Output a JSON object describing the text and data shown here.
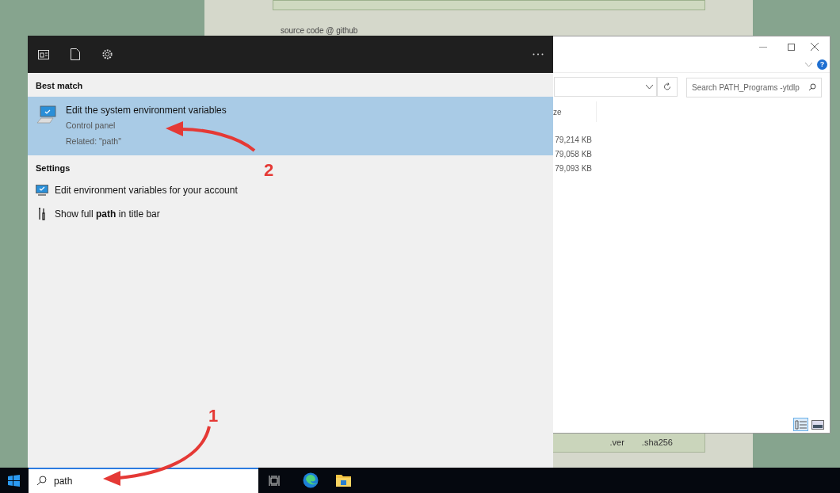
{
  "background_page": {
    "link": "source code @ github",
    "footer_items": [
      ".ver",
      ".sha256"
    ]
  },
  "explorer": {
    "help": "?",
    "search": {
      "placeholder": "Search PATH_Programs -ytdlp"
    },
    "column_header": "ze",
    "rows": [
      "79,214 KB",
      "79,058 KB",
      "79,093 KB"
    ],
    "views": [
      {
        "kind": "details",
        "selected": true
      },
      {
        "kind": "preview",
        "selected": false
      }
    ]
  },
  "start_menu": {
    "sections": [
      {
        "title": "Best match",
        "items": [
          {
            "kind": "computer",
            "title": "Edit the system environment variables",
            "subtitle": "Control panel",
            "related": "Related: \"path\"",
            "selected": true
          }
        ]
      },
      {
        "title": "Settings",
        "items": [
          {
            "kind": "monitor",
            "title": "Edit environment variables for your account",
            "selected": false
          },
          {
            "kind": "tools",
            "title": "Show full **path** in title bar",
            "selected": false
          }
        ]
      }
    ]
  },
  "taskbar": {
    "search": {
      "value": "path"
    }
  },
  "annotations": [
    {
      "label": "1"
    },
    {
      "label": "2"
    }
  ]
}
